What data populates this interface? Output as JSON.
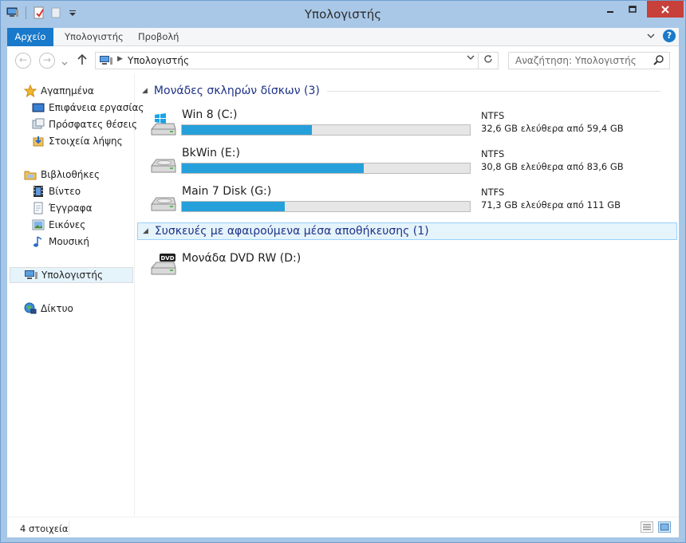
{
  "window": {
    "title": "Υπολογιστής"
  },
  "ribbon": {
    "tabs": [
      {
        "label": "Αρχείο"
      },
      {
        "label": "Υπολογιστής"
      },
      {
        "label": "Προβολή"
      }
    ]
  },
  "address": {
    "path": "Υπολογιστής",
    "search_placeholder": "Αναζήτηση: Υπολογιστής"
  },
  "sidebar": {
    "favorites": {
      "label": "Αγαπημένα",
      "items": [
        {
          "label": "Επιφάνεια εργασίας",
          "icon": "desktop-icon"
        },
        {
          "label": "Πρόσφατες θέσεις",
          "icon": "recent-places-icon"
        },
        {
          "label": "Στοιχεία λήψης",
          "icon": "downloads-icon"
        }
      ]
    },
    "libraries": {
      "label": "Βιβλιοθήκες",
      "items": [
        {
          "label": "Βίντεο",
          "icon": "videos-icon"
        },
        {
          "label": "Έγγραφα",
          "icon": "documents-icon"
        },
        {
          "label": "Εικόνες",
          "icon": "pictures-icon"
        },
        {
          "label": "Μουσική",
          "icon": "music-icon"
        }
      ]
    },
    "computer": {
      "label": "Υπολογιστής"
    },
    "network": {
      "label": "Δίκτυο"
    }
  },
  "main": {
    "hard_drives": {
      "header": "Μονάδες σκληρών δίσκων (3)",
      "drives": [
        {
          "name": "Win 8 (C:)",
          "fs": "NTFS",
          "free": "32,6 GB ελεύθερα από 59,4 GB",
          "used_fraction": 0.451,
          "icon": "windows-drive-icon"
        },
        {
          "name": "BkWin (E:)",
          "fs": "NTFS",
          "free": "30,8 GB ελεύθερα από 83,6 GB",
          "used_fraction": 0.632,
          "icon": "hard-drive-icon"
        },
        {
          "name": "Main 7 Disk (G:)",
          "fs": "NTFS",
          "free": "71,3 GB ελεύθερα από 111 GB",
          "used_fraction": 0.358,
          "icon": "hard-drive-icon"
        }
      ]
    },
    "removable": {
      "header": "Συσκευές με αφαιρούμενα μέσα αποθήκευσης (1)",
      "devices": [
        {
          "name": "Μονάδα DVD RW (D:)",
          "icon": "dvd-drive-icon",
          "icon_text": "DVD"
        }
      ]
    }
  },
  "status": {
    "count": "4 στοιχεία"
  },
  "colors": {
    "accent": "#1979ca",
    "bar_fill": "#26a0da",
    "group_header": "#1e3287"
  }
}
